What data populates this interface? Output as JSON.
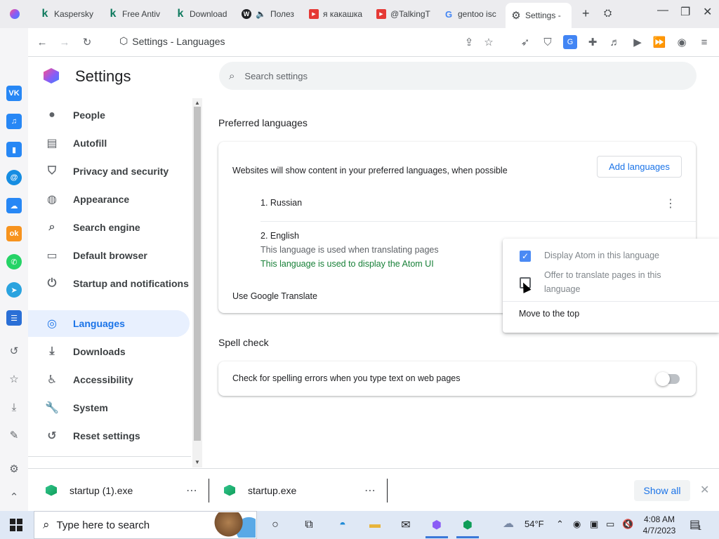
{
  "tabs": [
    {
      "title": "Kaspersky",
      "fav_text": "k",
      "fav_color": "#0f7a5e"
    },
    {
      "title": "Free Antiv",
      "fav_text": "k",
      "fav_color": "#0f7a5e"
    },
    {
      "title": "Download",
      "fav_text": "k",
      "fav_color": "#0f7a5e"
    },
    {
      "title": "Полез",
      "fav_text": "W",
      "fav_color": "#202124"
    },
    {
      "title": "я какашка",
      "fav_text": "▶",
      "fav_color": "#e53935"
    },
    {
      "title": "@TalkingT",
      "fav_text": "▶",
      "fav_color": "#e53935"
    },
    {
      "title": "gentoo isc",
      "fav_text": "G",
      "fav_color": "#4285f4"
    },
    {
      "title": "Settings -",
      "fav_text": "⚙",
      "fav_color": "#5f6368"
    }
  ],
  "toolbar": {
    "address": "Settings - Languages"
  },
  "settings": {
    "title": "Settings",
    "search_placeholder": "Search settings"
  },
  "nav": {
    "items": [
      {
        "label": "People",
        "icon": "person-icon"
      },
      {
        "label": "Autofill",
        "icon": "clipboard-icon"
      },
      {
        "label": "Privacy and security",
        "icon": "shield-icon"
      },
      {
        "label": "Appearance",
        "icon": "palette-icon"
      },
      {
        "label": "Search engine",
        "icon": "search-icon"
      },
      {
        "label": "Default browser",
        "icon": "browser-icon"
      },
      {
        "label": "Startup and notifications",
        "icon": "power-icon"
      },
      {
        "label": "Languages",
        "icon": "globe-icon"
      },
      {
        "label": "Downloads",
        "icon": "download-icon"
      },
      {
        "label": "Accessibility",
        "icon": "accessibility-icon"
      },
      {
        "label": "System",
        "icon": "wrench-icon"
      },
      {
        "label": "Reset settings",
        "icon": "history-icon"
      }
    ],
    "active": "Languages"
  },
  "preferred": {
    "section_title": "Preferred languages",
    "description": "Websites will show content in your preferred languages, when possible",
    "add_button": "Add languages",
    "languages": [
      {
        "label": "1. Russian"
      },
      {
        "label": "2. English",
        "note1": "This language is used when translating pages",
        "note2": "This language is used to display the Atom UI"
      }
    ],
    "google_translate": "Use Google Translate"
  },
  "spell": {
    "section_title": "Spell check",
    "label": "Check for spelling errors when you type text on web pages",
    "enabled": false
  },
  "context_menu": {
    "display_label": "Display Atom in this language",
    "display_checked": true,
    "offer_line1": "Offer to translate pages in this",
    "offer_line2": "language",
    "offer_checked": false,
    "move_top": "Move to the top"
  },
  "downloads": {
    "items": [
      {
        "name": "startup (1).exe"
      },
      {
        "name": "startup.exe"
      }
    ],
    "show_all": "Show all"
  },
  "taskbar": {
    "search_label": "Type here to search",
    "weather": "54°F",
    "time": "4:08 AM",
    "date": "4/7/2023",
    "notifications": "1"
  },
  "colors": {
    "accent": "#1a73e8",
    "note_green": "#188038",
    "muted": "#5f6368"
  }
}
